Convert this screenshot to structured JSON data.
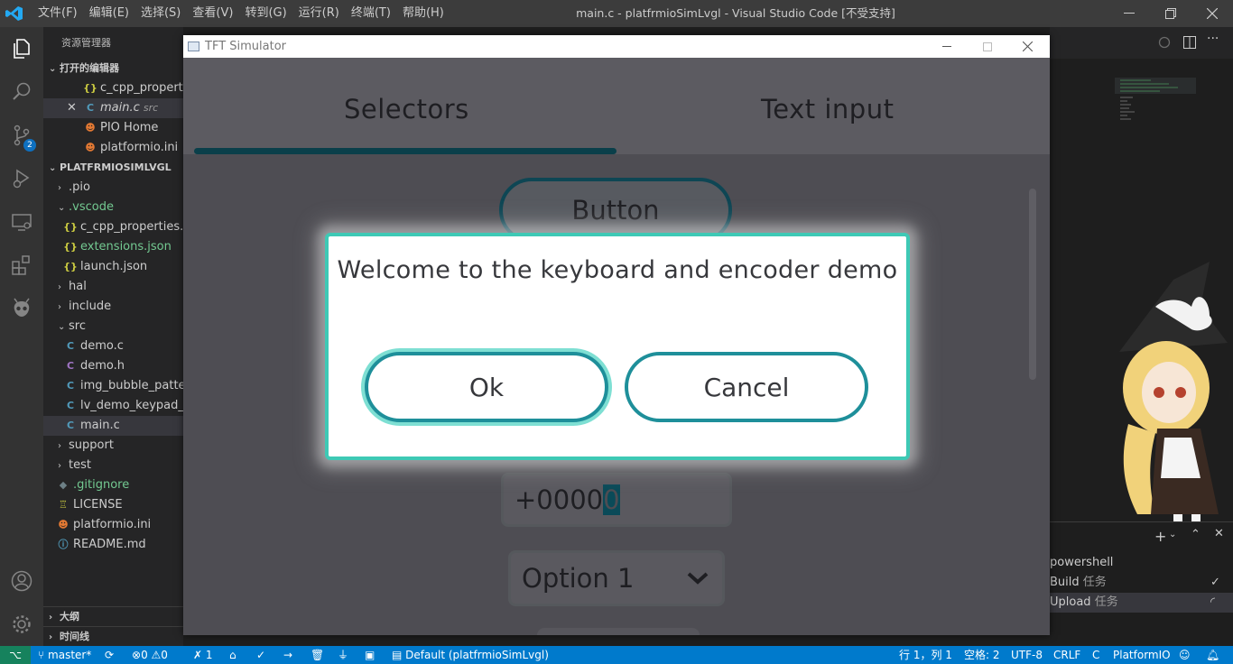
{
  "app": {
    "title": "main.c - platfrmioSimLvgl - Visual Studio Code [不受支持]",
    "menu": [
      "文件(F)",
      "编辑(E)",
      "选择(S)",
      "查看(V)",
      "转到(G)",
      "运行(R)",
      "终端(T)",
      "帮助(H)"
    ]
  },
  "activity": {
    "scm_badge": "2"
  },
  "sidebar": {
    "header": "资源管理器",
    "open_editors_title": "打开的编辑器",
    "open_editors": [
      {
        "icon": "{}",
        "name": "c_cpp_properties.json"
      },
      {
        "icon": "C",
        "name": "main.c",
        "hint": "src"
      },
      {
        "icon": "pio",
        "name": "PIO Home"
      },
      {
        "icon": "pio",
        "name": "platformio.ini"
      }
    ],
    "project_title": "PLATFRMIOSIMLVGL",
    "tree": {
      "pio": ".pio",
      "vscode": ".vscode",
      "c_cpp": "c_cpp_properties.json",
      "extensions": "extensions.json",
      "launch": "launch.json",
      "hal": "hal",
      "include": "include",
      "src": "src",
      "demo_c": "demo.c",
      "demo_h": "demo.h",
      "img_bubble": "img_bubble_pattern.c",
      "lv_demo": "lv_demo_keypad_encoder.c",
      "main_c": "main.c",
      "support": "support",
      "test": "test",
      "gitignore": ".gitignore",
      "license": "LICENSE",
      "platformio": "platformio.ini",
      "readme": "README.md"
    },
    "outline": "大纲",
    "timeline": "时间线"
  },
  "panel": {
    "terminals": [
      {
        "name": "powershell",
        "tag": ""
      },
      {
        "name": "Build",
        "tag": "任务"
      },
      {
        "name": "Upload",
        "tag": "任务"
      }
    ]
  },
  "statusbar": {
    "branch": "master*",
    "errors": "0",
    "warnings": "0",
    "tasks": "1",
    "env": "Default (platfrmioSimLvgl)",
    "position": "行 1，列 1",
    "spaces": "空格: 2",
    "encoding": "UTF-8",
    "eol": "CRLF",
    "lang": "C",
    "platform": "PlatformIO"
  },
  "simulator": {
    "window_title": "TFT Simulator",
    "tabs": [
      "Selectors",
      "Text input"
    ],
    "bg_button": "Button",
    "spinbox_value": "+0000",
    "spinbox_cursor": "0",
    "dropdown_value": "Option 1",
    "msgbox": {
      "text": "Welcome to the keyboard and encoder demo",
      "ok": "Ok",
      "cancel": "Cancel"
    }
  },
  "colors": {
    "accent": "#007acc",
    "msgbox_border": "#3ec9b5",
    "button_border": "#1e8f9a"
  }
}
